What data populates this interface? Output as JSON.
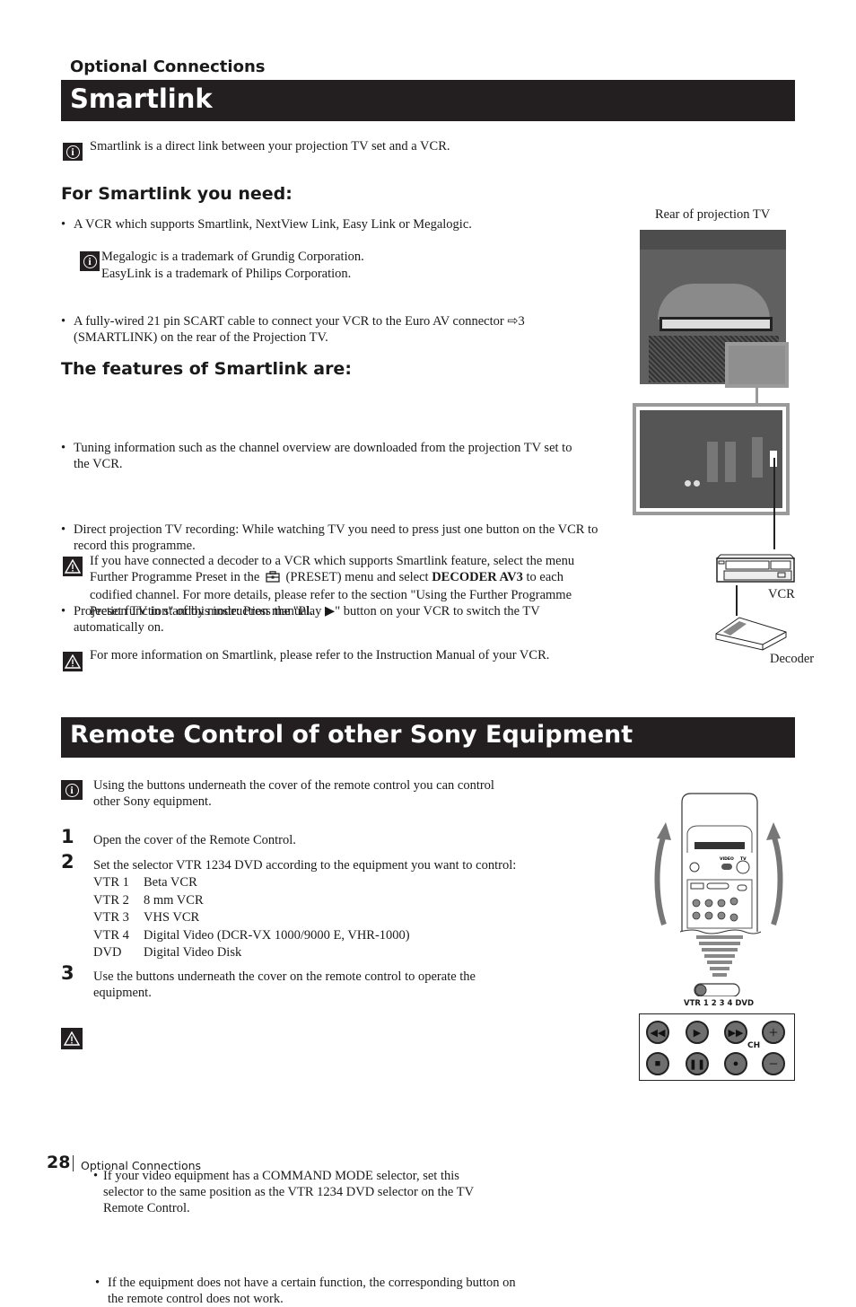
{
  "header": {
    "section_label": "Optional Connections",
    "title": "Smartlink"
  },
  "smartlink": {
    "intro": "Smartlink is a direct link between your projection TV set and a VCR.",
    "need_heading": "For Smartlink you need:",
    "need_items": [
      "A VCR which supports Smartlink, NextView Link, Easy Link or Megalogic.",
      "A fully-wired 21 pin SCART cable to connect your VCR to the Euro AV connector ⇨3 (SMARTLINK) on the rear of the Projection TV."
    ],
    "trademark_notes": [
      "Megalogic is a trademark of Grundig Corporation.",
      "EasyLink is a trademark of Philips Corporation."
    ],
    "features_heading": "The features of Smartlink are:",
    "features": [
      "Tuning information such as the channel overview are downloaded from the projection TV set to the VCR.",
      "Direct projection TV recording: While watching TV you need to press just one button on the VCR to record this programme.",
      "Projection TV in standby mode: Press the \"Play ▶\" button on your VCR to switch the TV automatically on."
    ],
    "warning1": {
      "part1": "If you have connected a decoder to a VCR which supports Smartlink feature, select the menu Further Programme Preset in the",
      "preset_icon": "preset-menu-icon",
      "part2": "(PRESET) menu and select",
      "bold": "DECODER AV3",
      "part3": "to each codified channel. For more details, please refer to the section \"Using the Further Programme Preset function\" of this instruction manual."
    },
    "warning2": "For more information on Smartlink, please refer to the Instruction Manual of your VCR.",
    "diagram": {
      "rear_label": "Rear of projection TV",
      "vcr_label": "VCR",
      "decoder_label": "Decoder"
    }
  },
  "remote": {
    "title": "Remote Control of other Sony Equipment",
    "intro": "Using the buttons underneath the cover of the remote control you can control other Sony equipment.",
    "steps": [
      {
        "num": "1",
        "text": "Open the cover of the Remote Control."
      },
      {
        "num": "2",
        "text": "Set the selector VTR 1234 DVD according to the equipment you want to control:"
      },
      {
        "num": "3",
        "text": "Use the buttons underneath the cover on the remote control to operate the equipment."
      }
    ],
    "selector_table": [
      {
        "key": "VTR 1",
        "value": "Beta VCR"
      },
      {
        "key": "VTR 2",
        "value": "8 mm VCR"
      },
      {
        "key": "VTR 3",
        "value": "VHS VCR"
      },
      {
        "key": "VTR 4",
        "value": "Digital Video (DCR-VX 1000/9000 E, VHR-1000)"
      },
      {
        "key": "DVD",
        "value": "Digital Video Disk"
      }
    ],
    "notes": [
      "If your video equipment has a COMMAND MODE selector, set this selector to the same position as the VTR 1234 DVD selector on the TV Remote Control.",
      "If the equipment does not have a certain function, the corresponding button on the remote control does not work."
    ],
    "illustration": {
      "video_label": "VIDEO",
      "tv_label": "TV",
      "selector_label": "VTR 1 2 3 4 DVD",
      "ch_label": "CH",
      "buttons": [
        "rewind",
        "play",
        "fast-forward",
        "channel-up",
        "stop",
        "pause",
        "record",
        "channel-down"
      ]
    }
  },
  "footer": {
    "page_number": "28",
    "section": "Optional Connections"
  }
}
